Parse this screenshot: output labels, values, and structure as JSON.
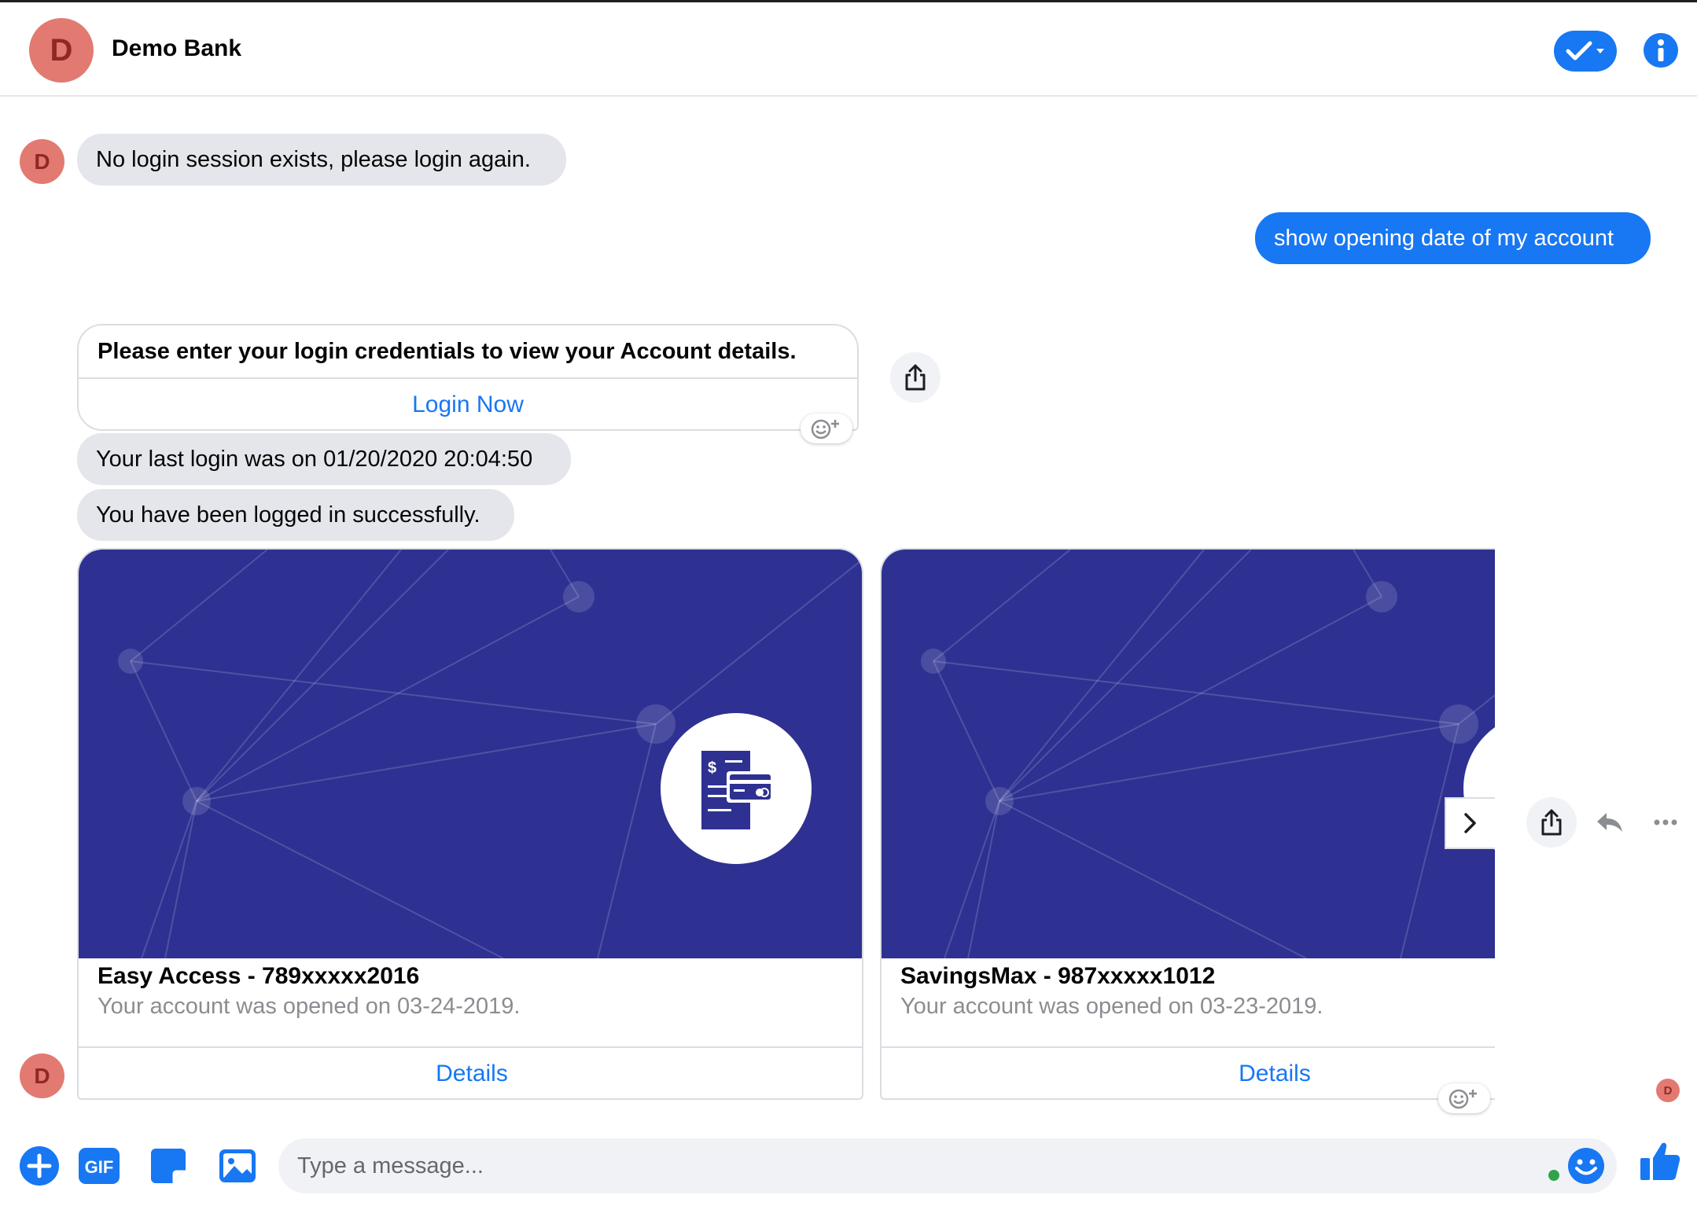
{
  "header": {
    "avatar_letter": "D",
    "title": "Demo Bank"
  },
  "messages": {
    "avatar_letter": "D",
    "m1": "No login session exists, please login again.",
    "m2_out": "show opening date of my account",
    "login_card": {
      "title": "Please enter your login credentials to view your Account details.",
      "button": "Login Now"
    },
    "m3": "Your last login was on 01/20/2020 20:04:50",
    "m4": "You have been logged in successfully."
  },
  "accounts": [
    {
      "title": "Easy Access - 789xxxxx2016",
      "subtitle": "Your account was opened on 03-24-2019.",
      "button": "Details"
    },
    {
      "title": "SavingsMax - 987xxxxx1012",
      "subtitle": "Your account was opened on 03-23-2019.",
      "button": "Details"
    }
  ],
  "seen_avatar_letter": "D",
  "composer": {
    "placeholder": "Type a message...",
    "gif_label": "GIF"
  },
  "colors": {
    "accent": "#1877f2",
    "bubble_in": "#e4e6eb",
    "card_hero": "#2e3191",
    "avatar": "#e27a72",
    "online": "#31a24c"
  },
  "icons": [
    "checkmark-icon",
    "info-icon",
    "share-icon",
    "add-reaction-icon",
    "chevron-right-icon",
    "reply-icon",
    "more-icon",
    "plus-icon",
    "gif-icon",
    "sticker-icon",
    "image-icon",
    "emoji-icon",
    "thumbs-up-icon",
    "account-statement-icon"
  ]
}
